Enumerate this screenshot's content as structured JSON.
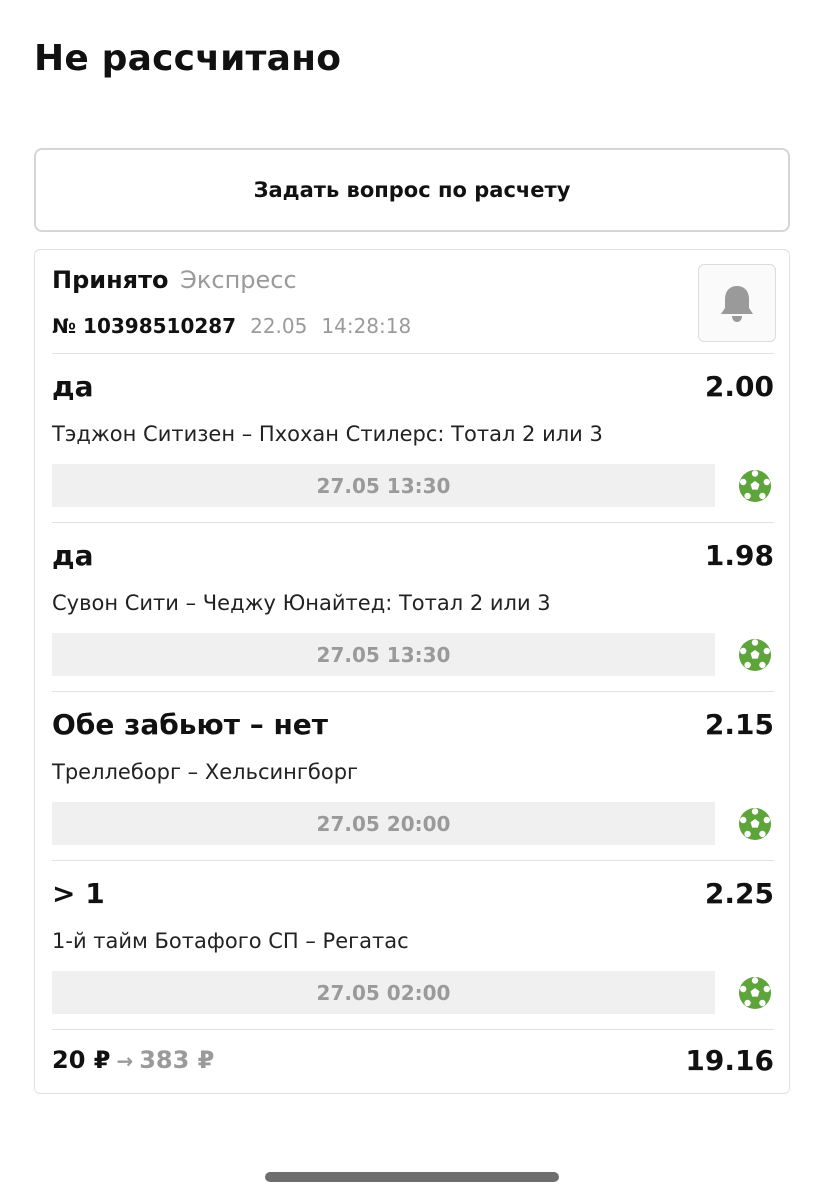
{
  "header": {
    "title": "Не рассчитано"
  },
  "actions": {
    "ask_label": "Задать вопрос по расчету"
  },
  "bet": {
    "status": "Принято",
    "type": "Экспресс",
    "number": "№ 10398510287",
    "date": "22.05",
    "time": "14:28:18",
    "bell_icon": "bell-icon",
    "items": [
      {
        "outcome": "да",
        "odds": "2.00",
        "match": "Тэджон Ситизен – Пхохан Стилерс: Тотал 2 или 3",
        "datetime": "27.05 13:30",
        "sport_icon": "soccer-ball-icon"
      },
      {
        "outcome": "да",
        "odds": "1.98",
        "match": "Сувон Сити – Чеджу Юнайтед: Тотал 2 или 3",
        "datetime": "27.05 13:30",
        "sport_icon": "soccer-ball-icon"
      },
      {
        "outcome": "Обе забьют – нет",
        "odds": "2.15",
        "match": "Треллеборг – Хельсингборг",
        "datetime": "27.05 20:00",
        "sport_icon": "soccer-ball-icon"
      },
      {
        "outcome": "> 1",
        "odds": "2.25",
        "match": "1-й тайм Ботафого СП – Регатас",
        "datetime": "27.05 02:00",
        "sport_icon": "soccer-ball-icon"
      }
    ],
    "stake": "20 ₽",
    "arrow": "→",
    "payout": "383 ₽",
    "total_odds": "19.16"
  },
  "colors": {
    "accent_green": "#5da43a",
    "muted_text": "#9a9a9a",
    "divider": "#e2e2e2",
    "time_bg": "#f0f0f0"
  }
}
